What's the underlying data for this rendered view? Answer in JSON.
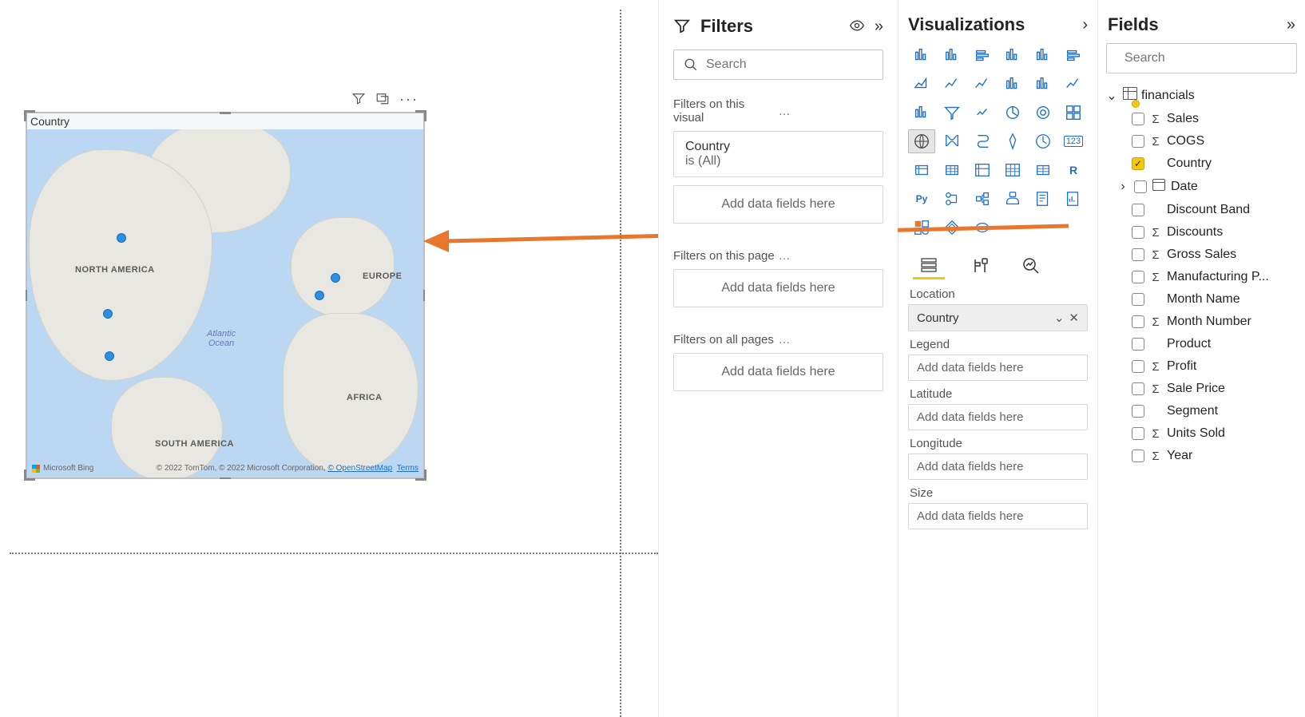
{
  "map_visual": {
    "title": "Country",
    "labels": {
      "na": "NORTH AMERICA",
      "sa": "SOUTH AMERICA",
      "eu": "EUROPE",
      "af": "AFRICA",
      "ocean": "Atlantic\nOcean"
    },
    "attrib_left": "Microsoft Bing",
    "attrib_right_prefix": "© 2022 TomTom, © 2022 Microsoft Corporation, ",
    "attrib_link": "© OpenStreetMap",
    "attrib_terms": "Terms"
  },
  "filters": {
    "title": "Filters",
    "search_placeholder": "Search",
    "section_visual": "Filters on this visual",
    "section_page": "Filters on this page",
    "section_all": "Filters on all pages",
    "card_country_title": "Country",
    "card_country_sub": "is (All)",
    "drop_text": "Add data fields here"
  },
  "viz": {
    "title": "Visualizations",
    "wells": {
      "location": {
        "label": "Location",
        "value": "Country"
      },
      "legend": {
        "label": "Legend",
        "placeholder": "Add data fields here"
      },
      "latitude": {
        "label": "Latitude",
        "placeholder": "Add data fields here"
      },
      "longitude": {
        "label": "Longitude",
        "placeholder": "Add data fields here"
      },
      "size": {
        "label": "Size",
        "placeholder": "Add data fields here"
      }
    }
  },
  "fields": {
    "title": "Fields",
    "search_placeholder": "Search",
    "table": "financials",
    "items": [
      {
        "name": "Sales",
        "sigma": true
      },
      {
        "name": "COGS",
        "sigma": true
      },
      {
        "name": "Country",
        "checked": true
      },
      {
        "name": "Date",
        "date": true,
        "expand": true
      },
      {
        "name": "Discount Band"
      },
      {
        "name": "Discounts",
        "sigma": true
      },
      {
        "name": "Gross Sales",
        "sigma": true
      },
      {
        "name": "Manufacturing P...",
        "sigma": true
      },
      {
        "name": "Month Name"
      },
      {
        "name": "Month Number",
        "sigma": true
      },
      {
        "name": "Product"
      },
      {
        "name": "Profit",
        "sigma": true
      },
      {
        "name": "Sale Price",
        "sigma": true
      },
      {
        "name": "Segment"
      },
      {
        "name": "Units Sold",
        "sigma": true
      },
      {
        "name": "Year",
        "sigma": true
      }
    ]
  }
}
